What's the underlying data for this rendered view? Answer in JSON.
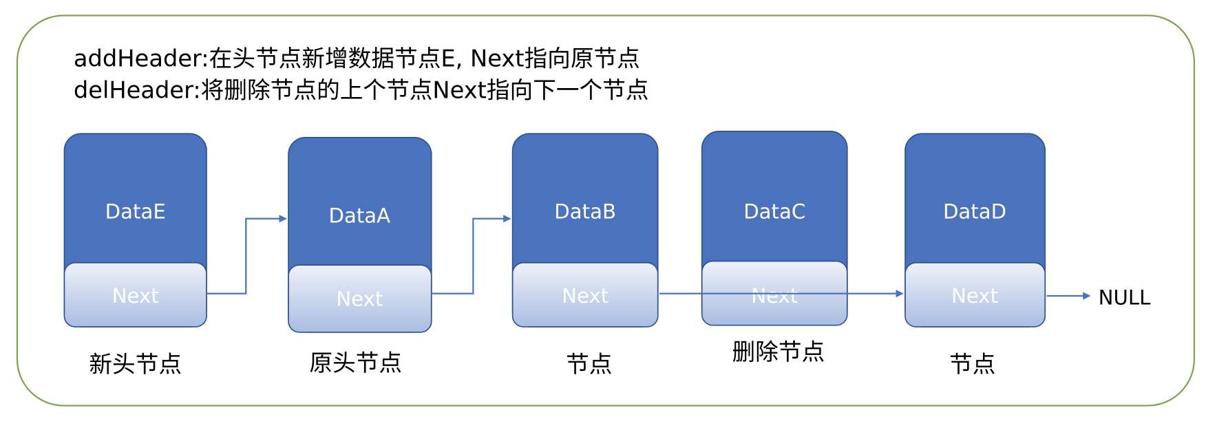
{
  "description": {
    "line1": "addHeader:在头节点新增数据节点E, Next指向原节点",
    "line2": "delHeader:将删除节点的上个节点Next指向下一个节点"
  },
  "nodes": [
    {
      "data": "DataE",
      "next": "Next",
      "caption": "新头节点"
    },
    {
      "data": "DataA",
      "next": "Next",
      "caption": "原头节点"
    },
    {
      "data": "DataB",
      "next": "Next",
      "caption": "节点"
    },
    {
      "data": "DataC",
      "next": "Next",
      "caption": "删除节点"
    },
    {
      "data": "DataD",
      "next": "Next",
      "caption": "节点"
    }
  ],
  "null_label": "NULL",
  "colors": {
    "frame": "#7fa253",
    "node": "#4a72bd",
    "arrow": "#4a72bd"
  }
}
